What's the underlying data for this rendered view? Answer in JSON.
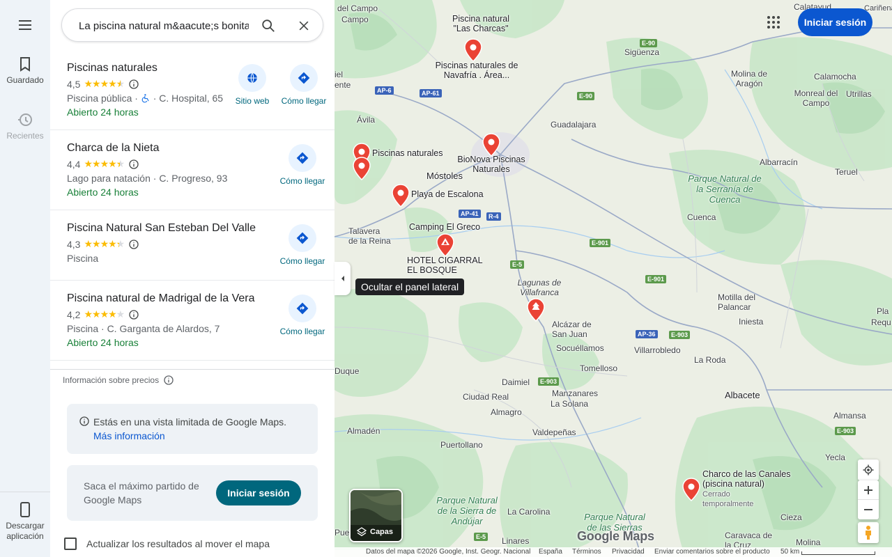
{
  "rail": {
    "menu_icon": "menu-icon",
    "saved_label": "Guardado",
    "recent_label": "Recientes",
    "download_label": "Descargar aplicación"
  },
  "search": {
    "value": "La piscina natural m&aacute;s bonita",
    "search_icon": "search-icon",
    "close_icon": "close-icon"
  },
  "results": [
    {
      "title": "Piscinas naturales",
      "rating": "4,5",
      "stars": 4.5,
      "meta_before": "Piscina pública · ",
      "meta_after": " · C. Hospital, 65",
      "wheelchair": true,
      "open": "Abierto 24 horas",
      "website_label": "Sitio web",
      "directions_label": "Cómo llegar"
    },
    {
      "title": "Charca de la Nieta",
      "rating": "4,4",
      "stars": 4.4,
      "meta": "Lago para natación · C. Progreso, 93",
      "open": "Abierto 24 horas",
      "directions_label": "Cómo llegar"
    },
    {
      "title": "Piscina Natural San Esteban Del Valle",
      "rating": "4,3",
      "stars": 4.3,
      "meta": "Piscina",
      "directions_label": "Cómo llegar"
    },
    {
      "title": "Piscina natural de Madrigal de la Vera",
      "rating": "4,2",
      "stars": 4.2,
      "meta": "Piscina · C. Garganta de Alardos, 7",
      "open": "Abierto 24 horas",
      "directions_label": "Cómo llegar"
    }
  ],
  "price_info": "Información sobre precios",
  "limited_view": {
    "text": "Estás en una vista limitada de Google Maps.",
    "link": "Más información"
  },
  "signin_promo": {
    "text": "Saca el máximo partido de Google Maps",
    "button": "Iniciar sesión"
  },
  "update_results_label": "Actualizar los resultados al mover el mapa",
  "map": {
    "collapse_tooltip": "Ocultar el panel lateral",
    "signin_button": "Iniciar sesión",
    "layers_label": "Capas",
    "logo": "Google Maps",
    "place_labels": {
      "del_campo": "del Campo",
      "siguenza": "Sigüenza",
      "calatayud": "Calatayud",
      "carinena": "Cariñena",
      "calamocha": "Calamocha",
      "molina": "Molina de Aragón",
      "monreal": "Monreal del Campo",
      "utrillas": "Utrillas",
      "avila": "Ávila",
      "guadalajara": "Guadalajara",
      "albarracin": "Albarracín",
      "teruel": "Teruel",
      "mostoles": "Móstoles",
      "cuenca": "Cuenca",
      "talavera": "Talavera de la Reina",
      "motilla": "Motilla del Palancar",
      "iniesta": "Iniesta",
      "alcazar": "Alcázar de San Juan",
      "socuellamos": "Socuéllamos",
      "villarrobledo": "Villarrobledo",
      "la_roda": "La Roda",
      "tomelloso": "Tomelloso",
      "daimiel": "Daimiel",
      "manzanares": "Manzanares",
      "la_solana": "La Solana",
      "ciudad_real": "Ciudad Real",
      "albacete": "Albacete",
      "almagro": "Almagro",
      "valdepenas": "Valdepeñas",
      "almaden": "Almadén",
      "puertollano": "Puertollano",
      "almansa": "Almansa",
      "yecla": "Yecla",
      "la_carolina": "La Carolina",
      "cieza": "Cieza",
      "caravaca": "Caravaca de la Cruz",
      "molina_segura": "Molina",
      "linares": "Linares",
      "requena": "Requ",
      "duque": "Duque",
      "ente": "ente",
      "puebl": "Puebl",
      "iel": "iel",
      "pla": "Pla"
    },
    "park_labels": {
      "cuenca_park": "Parque Natural de la Serranía de Cuenca",
      "andujar_park": "Parque Natural de la Sierra de Andújar",
      "sierras_park": "Parque Natural de las Sierras"
    },
    "lagunas": "Lagunas de Villafranca",
    "poi_labels": {
      "las_charcas": "Piscina natural \"Las Charcas\"",
      "navafria": "Piscinas naturales de Navafría . Área...",
      "piscinas_naturales": "Piscinas naturales",
      "bionova": "BioNova Piscinas Naturales",
      "escalona": "Playa de Escalona",
      "camping": "Camping El Greco",
      "cigarral": "HOTEL CIGARRAL EL BOSQUE",
      "charco_canales": "Charco de las Canales (piscina natural)",
      "cerrado": "Cerrado temporalmente"
    },
    "roads": {
      "ap6": "AP-6",
      "ap61": "AP-61",
      "e90": "E-90",
      "e90b": "E-90",
      "ap41": "AP-41",
      "r4": "R-4",
      "e901": "E-901",
      "e901b": "E-901",
      "e5": "E-5",
      "ap36": "AP-36",
      "e903": "E-903",
      "e903b": "E-903",
      "e903c": "E-903",
      "e5b": "E-5"
    },
    "footer": {
      "data": "Datos del mapa ©2026 Google, Inst. Geogr. Nacional",
      "spain": "España",
      "terms": "Términos",
      "privacy": "Privacidad",
      "feedback": "Enviar comentarios sobre el producto",
      "scale": "50 km"
    }
  },
  "colors": {
    "accent_blue": "#0b57d0",
    "teal": "#00677d",
    "open_green": "#188038",
    "pin_red": "#ea4335",
    "star": "#fbbc04"
  }
}
